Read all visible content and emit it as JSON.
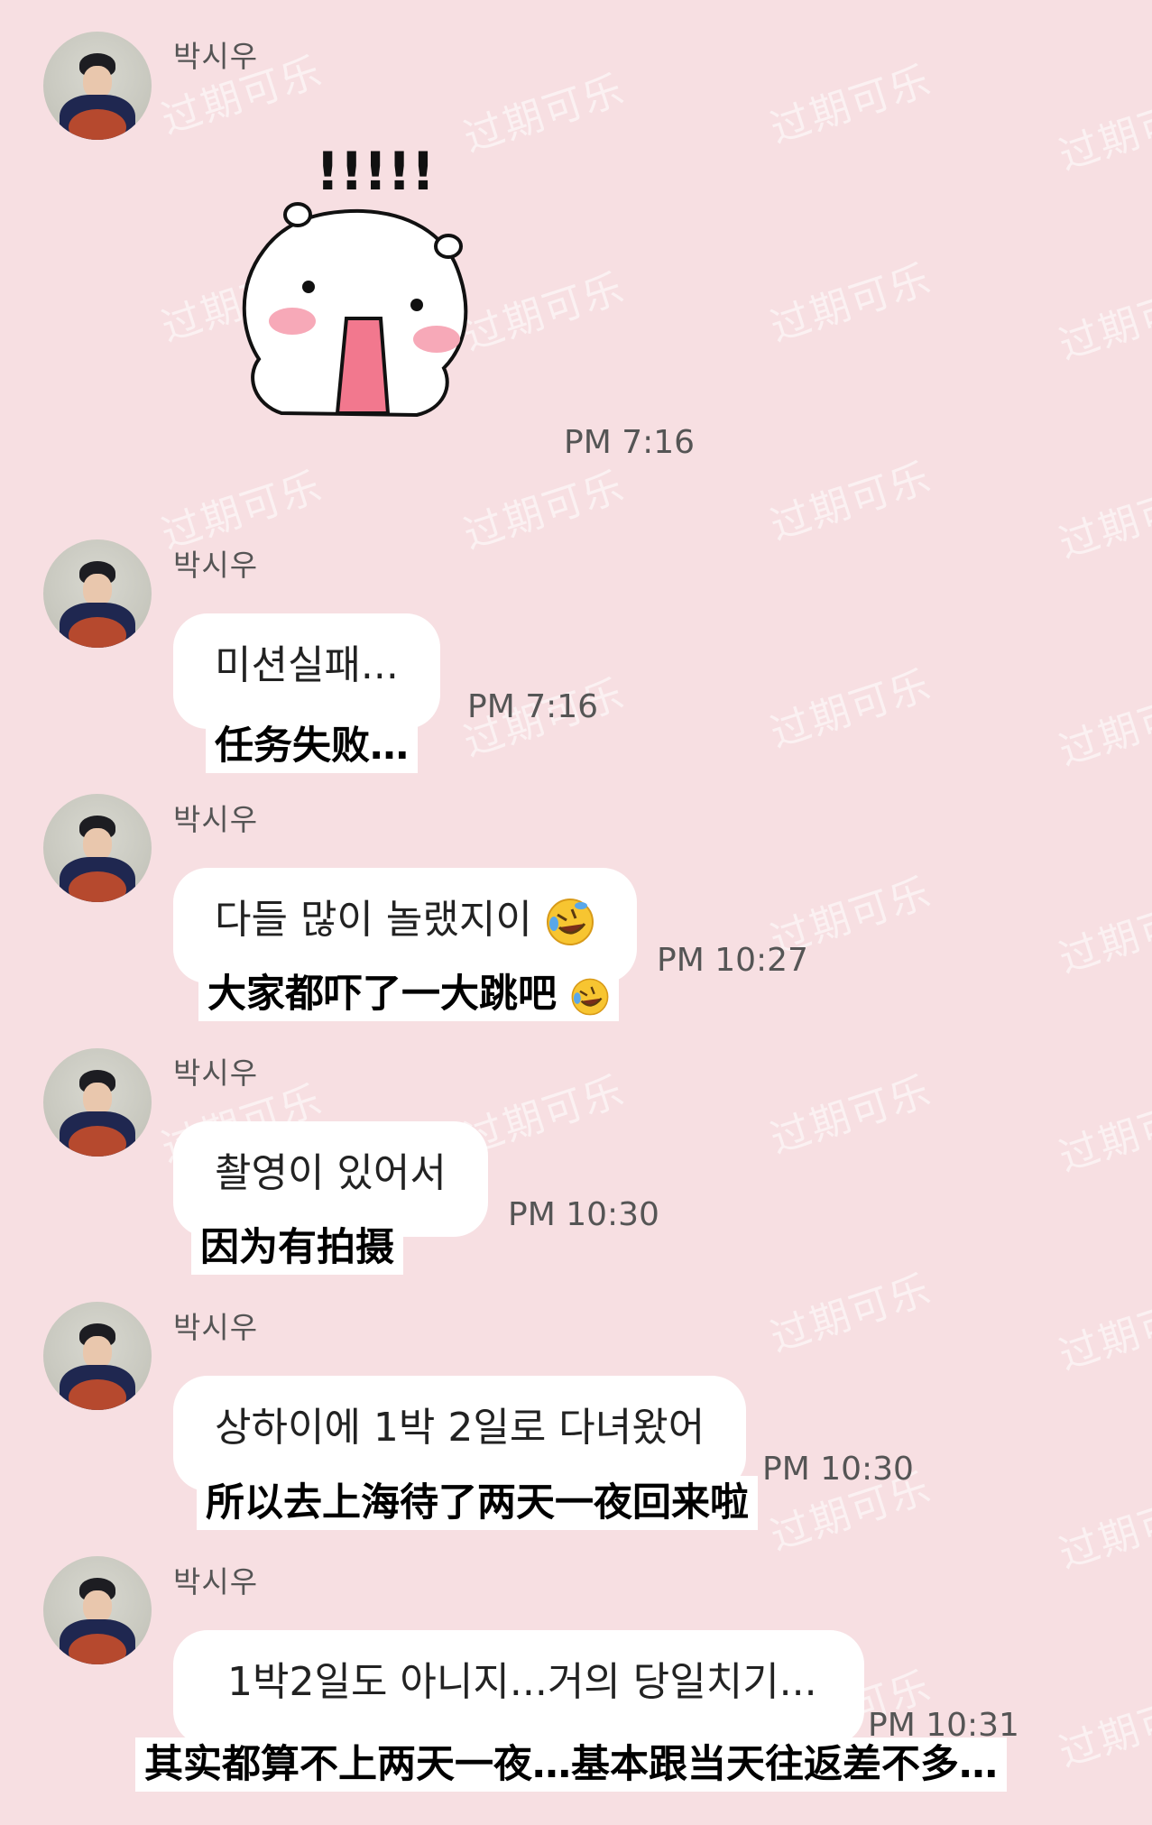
{
  "sender": "박시우",
  "messages": [
    {
      "id": "m1",
      "type": "sticker",
      "sticker_text": "!!!!!",
      "time": "PM 7:16"
    },
    {
      "id": "m2",
      "type": "text",
      "text": "미션실패...",
      "translation": "任务失败…",
      "time": "PM 7:16"
    },
    {
      "id": "m3",
      "type": "text",
      "text": "다들 많이 놀랬지이",
      "translation": "大家都吓了一大跳吧",
      "emoji": "rolling-on-floor-laughing",
      "time": "PM 10:27"
    },
    {
      "id": "m4",
      "type": "text",
      "text": "촬영이 있어서",
      "translation": "因为有拍摄",
      "time": "PM 10:30"
    },
    {
      "id": "m5",
      "type": "text",
      "text": "상하이에 1박 2일로 다녀왔어",
      "translation": "所以去上海待了两天一夜回来啦",
      "time": "PM 10:30"
    },
    {
      "id": "m6",
      "type": "text",
      "text": "1박2일도 아니지...거의 당일치기...",
      "translation": "其实都算不上两天一夜…基本跟当天往返差不多…",
      "time": "PM 10:31"
    }
  ],
  "watermark": "过期可乐",
  "colors": {
    "background": "#f7dfe2",
    "bubble": "#ffffff",
    "sticker_tongue": "#f2788e",
    "sticker_blush": "#f7a9b8"
  }
}
